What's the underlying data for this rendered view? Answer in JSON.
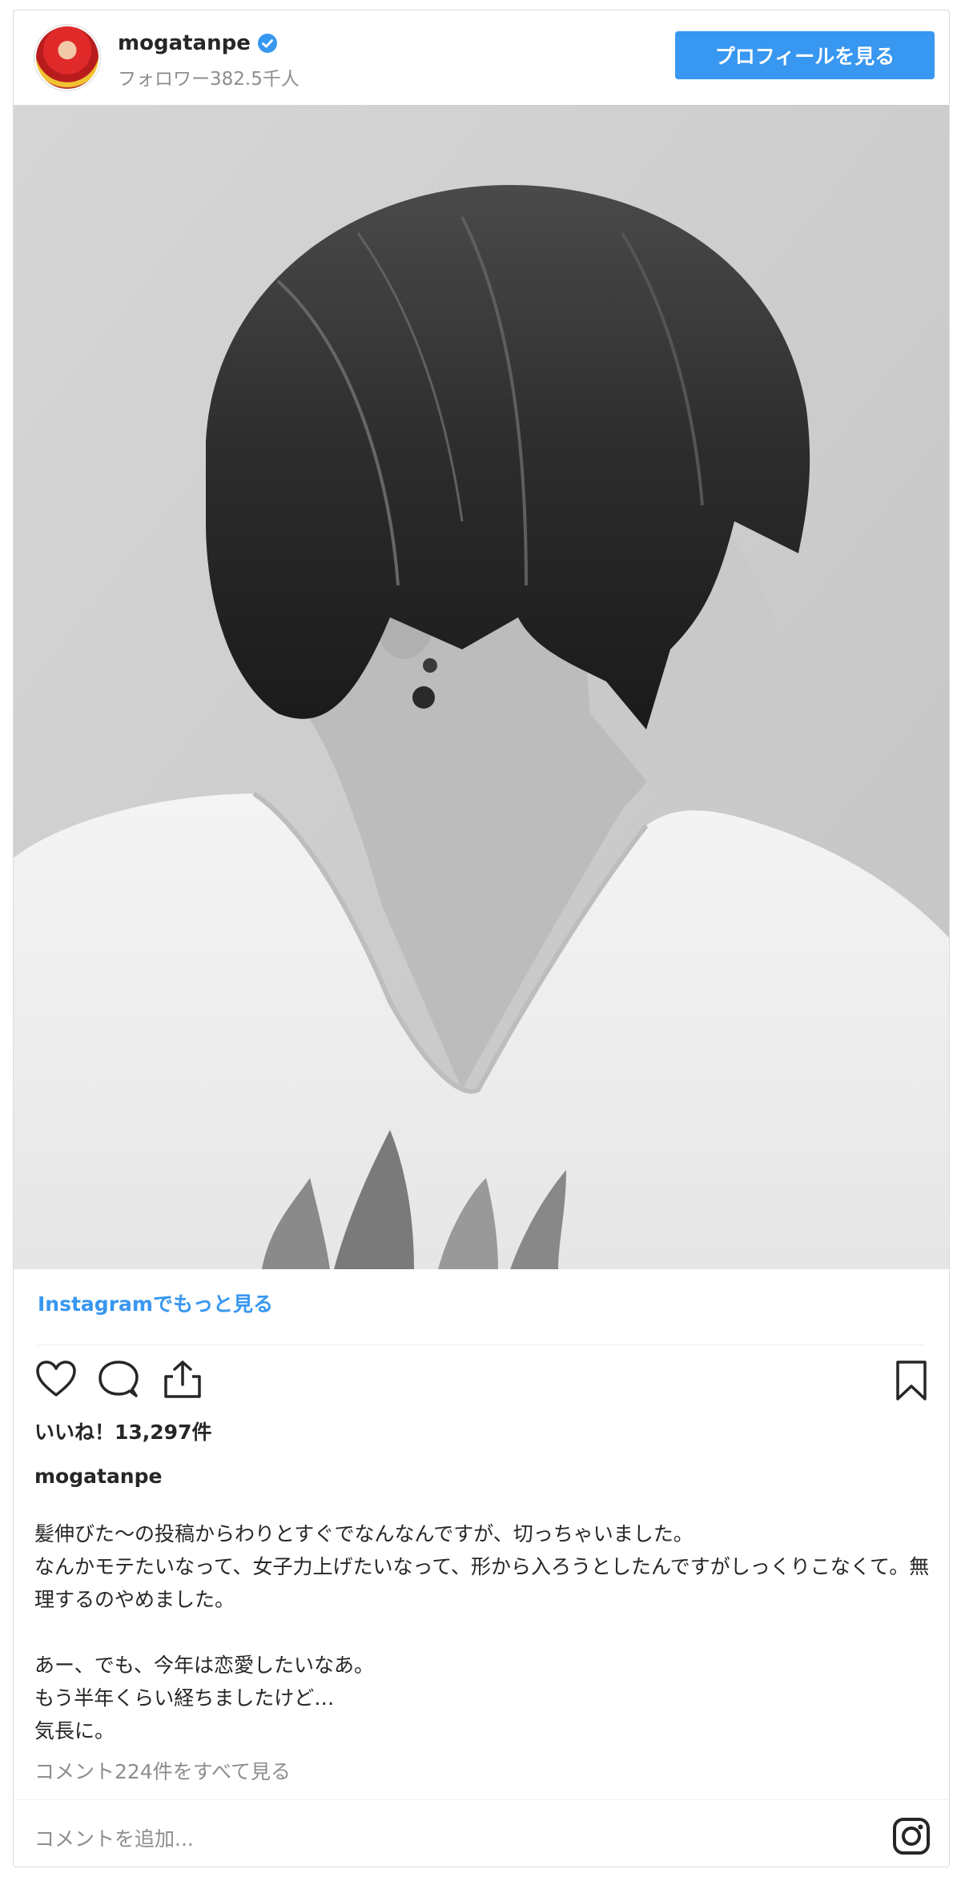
{
  "header": {
    "username": "mogatanpe",
    "followers": "フォロワー382.5千人",
    "profile_button": "プロフィールを見る",
    "verified_icon": "verified-badge-icon",
    "accent": "#3897f0"
  },
  "more_link": "Instagramでもっと見る",
  "actions": {
    "icons": [
      "heart-icon",
      "comment-icon",
      "share-icon",
      "bookmark-icon"
    ]
  },
  "likes": "いいね！13,297件",
  "caption": {
    "username": "mogatanpe",
    "lines": [
      "髪伸びた〜の投稿からわりとすぐでなんなんですが、切っちゃいました。",
      "なんかモテたいなって、女子力上げたいなって、形から入ろうとしたんですがしっくりこなくて。無理するのやめました。",
      "",
      "あー、でも、今年は恋愛したいなあ。",
      "もう半年くらい経ちましたけど…",
      "気長に。"
    ]
  },
  "comments_link": "コメント224件をすべて見る",
  "comment_input": {
    "placeholder": "コメントを追加..."
  }
}
